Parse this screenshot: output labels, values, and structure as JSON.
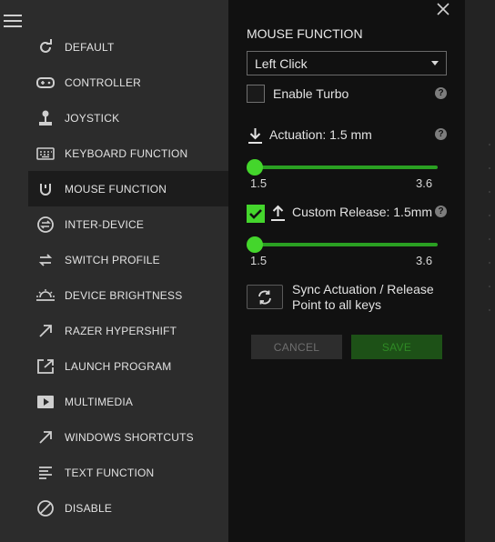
{
  "sidebar": {
    "items": [
      {
        "label": "DEFAULT",
        "icon": "refresh-icon"
      },
      {
        "label": "CONTROLLER",
        "icon": "gamepad-icon"
      },
      {
        "label": "JOYSTICK",
        "icon": "joystick-icon"
      },
      {
        "label": "KEYBOARD FUNCTION",
        "icon": "keyboard-icon"
      },
      {
        "label": "MOUSE FUNCTION",
        "icon": "mouse-icon",
        "active": true
      },
      {
        "label": "INTER-DEVICE",
        "icon": "inter-device-icon"
      },
      {
        "label": "SWITCH PROFILE",
        "icon": "switch-arrows-icon"
      },
      {
        "label": "DEVICE BRIGHTNESS",
        "icon": "brightness-icon"
      },
      {
        "label": "RAZER HYPERSHIFT",
        "icon": "diagonal-arrow-icon"
      },
      {
        "label": "LAUNCH PROGRAM",
        "icon": "launch-icon"
      },
      {
        "label": "MULTIMEDIA",
        "icon": "play-icon"
      },
      {
        "label": "WINDOWS SHORTCUTS",
        "icon": "diagonal-arrow-icon"
      },
      {
        "label": "TEXT FUNCTION",
        "icon": "text-lines-icon"
      },
      {
        "label": "DISABLE",
        "icon": "disable-icon"
      }
    ]
  },
  "panel": {
    "heading": "MOUSE FUNCTION",
    "select_value": "Left Click",
    "turbo": {
      "label": "Enable Turbo",
      "checked": false
    },
    "actuation": {
      "label": "Actuation: 1.5 mm",
      "min": "1.5",
      "max": "3.6",
      "value": 1.5
    },
    "release": {
      "label": "Custom Release: 1.5mm",
      "checked": true,
      "min": "1.5",
      "max": "3.6",
      "value": 1.5
    },
    "help_glyph": "?",
    "sync_text": "Sync Actuation / Release Point to all keys",
    "cancel_label": "CANCEL",
    "save_label": "SAVE"
  },
  "colors": {
    "accent": "#44d62c",
    "sidebar_bg": "#2c2c2c",
    "panel_bg": "#111111"
  }
}
